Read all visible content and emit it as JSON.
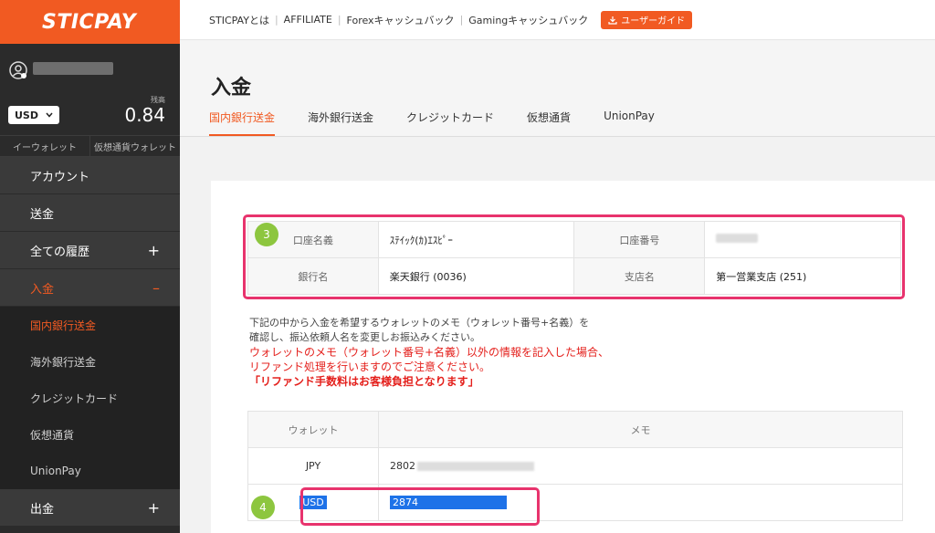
{
  "brand": {
    "logo": "STICPAY"
  },
  "balance": {
    "label": "残高",
    "value": "0.84"
  },
  "currency": {
    "selected": "USD"
  },
  "wallet_tabs": [
    "イーウォレット",
    "仮想通貨ウォレット"
  ],
  "menu": [
    {
      "label": "アカウント"
    },
    {
      "label": "送金"
    },
    {
      "label": "全ての履歴",
      "sign": "+"
    },
    {
      "label": "入金",
      "sign": "–"
    },
    {
      "label": "出金",
      "sign": "+"
    }
  ],
  "submenu": [
    "国内銀行送金",
    "海外銀行送金",
    "クレジットカード",
    "仮想通貨",
    "UnionPay"
  ],
  "topnav": {
    "links": [
      "STICPAYとは",
      "AFFILIATE",
      "Forexキャッシュバック",
      "Gamingキャッシュバック"
    ],
    "guide": "ユーザーガイド"
  },
  "page": {
    "title": "入金"
  },
  "tabs": [
    "国内銀行送金",
    "海外銀行送金",
    "クレジットカード",
    "仮想通貨",
    "UnionPay"
  ],
  "account": {
    "name_label": "口座名義",
    "name_value": "ｽﾃｲｯｸ(ｶ)ｴｽﾋﾟｰ",
    "number_label": "口座番号",
    "bank_label": "銀行名",
    "bank_value": "楽天銀行 (0036)",
    "branch_label": "支店名",
    "branch_value": "第一営業支店 (251)"
  },
  "badges": {
    "b3": "3",
    "b4": "4"
  },
  "notes": {
    "line1": "下記の中から入金を希望するウォレットのメモ（ウォレット番号+名義）を",
    "line2": "確認し、振込依頼人名を変更しお振込みください。",
    "warn1": "ウォレットのメモ（ウォレット番号+名義）以外の情報を記入した場合、",
    "warn2": "リファンド処理を行いますのでご注意ください。",
    "strong": "「リファンド手数料はお客様負担となります」"
  },
  "wallet_table": {
    "headers": [
      "ウォレット",
      "メモ"
    ],
    "rows": [
      {
        "wallet": "JPY",
        "memo": "2802"
      },
      {
        "wallet": "USD",
        "memo": "2874"
      }
    ]
  },
  "colors": {
    "accent": "#f15a22",
    "highlight": "#e8336d",
    "badge": "#8dc63f",
    "selection": "#1e72e8"
  }
}
